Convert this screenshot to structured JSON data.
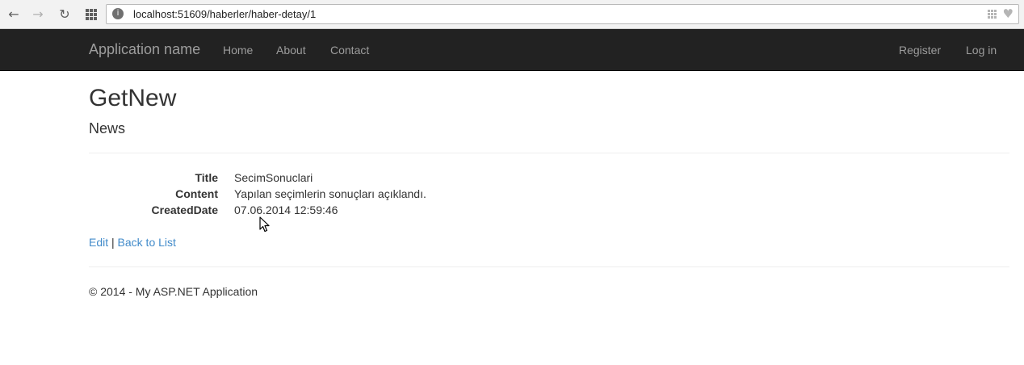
{
  "browser": {
    "url": "localhost:51609/haberler/haber-detay/1"
  },
  "navbar": {
    "brand": "Application name",
    "links": [
      "Home",
      "About",
      "Contact"
    ],
    "right_links": [
      "Register",
      "Log in"
    ]
  },
  "page": {
    "title": "GetNew",
    "subtitle": "News"
  },
  "details": [
    {
      "label": "Title",
      "value": "SecimSonuclari"
    },
    {
      "label": "Content",
      "value": "Yapılan seçimlerin sonuçları açıklandı."
    },
    {
      "label": "CreatedDate",
      "value": "07.06.2014 12:59:46"
    }
  ],
  "actions": {
    "edit": "Edit",
    "separator": "|",
    "back": "Back to List"
  },
  "footer": {
    "text": "© 2014 - My ASP.NET Application"
  },
  "icons": {
    "back": "back-arrow-icon",
    "forward": "forward-arrow-icon",
    "reload": "reload-icon",
    "apps": "apps-grid-icon",
    "site": "site-info-icon",
    "bookmark": "bookmark-heart-icon",
    "cursor": "mouse-cursor-icon"
  },
  "colors": {
    "navbar_bg": "#222222",
    "navbar_text": "#9d9d9d",
    "link": "#428bca",
    "text": "#333333"
  }
}
